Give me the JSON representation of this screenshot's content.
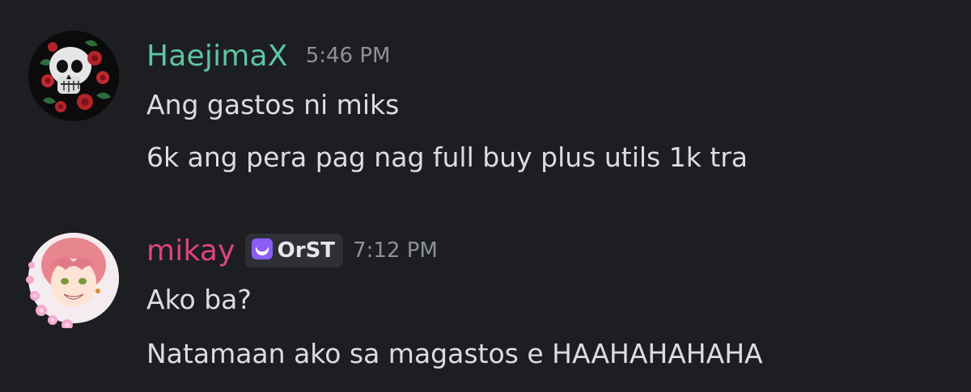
{
  "messages": [
    {
      "username": "HaejimaX",
      "username_color": "#5ec4a2",
      "timestamp": "5:46 PM",
      "avatar_icon": "skull-roses-avatar",
      "lines": [
        "Ang gastos ni miks",
        "6k ang pera pag nag full buy plus utils 1k tra"
      ]
    },
    {
      "username": "mikay",
      "username_color": "#e0457b",
      "timestamp": "7:12 PM",
      "avatar_icon": "anime-girl-avatar",
      "badge": {
        "icon": "crescent-moon-icon",
        "label": "OrST",
        "color": "#a78bfa"
      },
      "lines": [
        "Ako ba?",
        "Natamaan ako sa magastos e HAAHAHAHAHA"
      ]
    }
  ]
}
